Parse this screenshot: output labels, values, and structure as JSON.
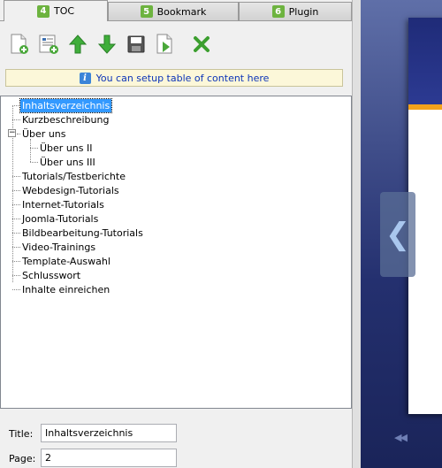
{
  "tabs": [
    {
      "num": "4",
      "label": "TOC"
    },
    {
      "num": "5",
      "label": "Bookmark"
    },
    {
      "num": "6",
      "label": "Plugin"
    }
  ],
  "toolbar": {
    "icons": [
      "add-page-icon",
      "add-child-icon",
      "move-up-icon",
      "move-down-icon",
      "save-icon",
      "export-icon",
      "delete-icon"
    ]
  },
  "info": {
    "icon": "info-icon",
    "text": "You can setup table of content here"
  },
  "tree": {
    "items": [
      {
        "label": "Inhaltsverzeichnis",
        "level": 0,
        "selected": true
      },
      {
        "label": "Kurzbeschreibung",
        "level": 0
      },
      {
        "label": "Über uns",
        "level": 0,
        "expanded": true
      },
      {
        "label": "Über uns II",
        "level": 1
      },
      {
        "label": "Über uns III",
        "level": 1
      },
      {
        "label": "Tutorials/Testberichte",
        "level": 0
      },
      {
        "label": "Webdesign-Tutorials",
        "level": 0
      },
      {
        "label": "Internet-Tutorials",
        "level": 0
      },
      {
        "label": "Joomla-Tutorials",
        "level": 0
      },
      {
        "label": "Bildbearbeitung-Tutorials",
        "level": 0
      },
      {
        "label": "Video-Trainings",
        "level": 0
      },
      {
        "label": "Template-Auswahl",
        "level": 0
      },
      {
        "label": "Schlusswort",
        "level": 0
      },
      {
        "label": "Inhalte einreichen",
        "level": 0
      }
    ],
    "toggle_symbol": "−"
  },
  "fields": {
    "title_label": "Title:",
    "title_value": "Inhaltsverzeichnis",
    "page_label": "Page:",
    "page_value": "2"
  },
  "preview": {
    "nav_prev_glyph": "❮",
    "rewind_glyph": "◀◀"
  },
  "colors": {
    "accent": "#3399ff",
    "tab_badge": "#6db33f",
    "info_text": "#0c34b8",
    "page_accent": "#f3a21b"
  }
}
